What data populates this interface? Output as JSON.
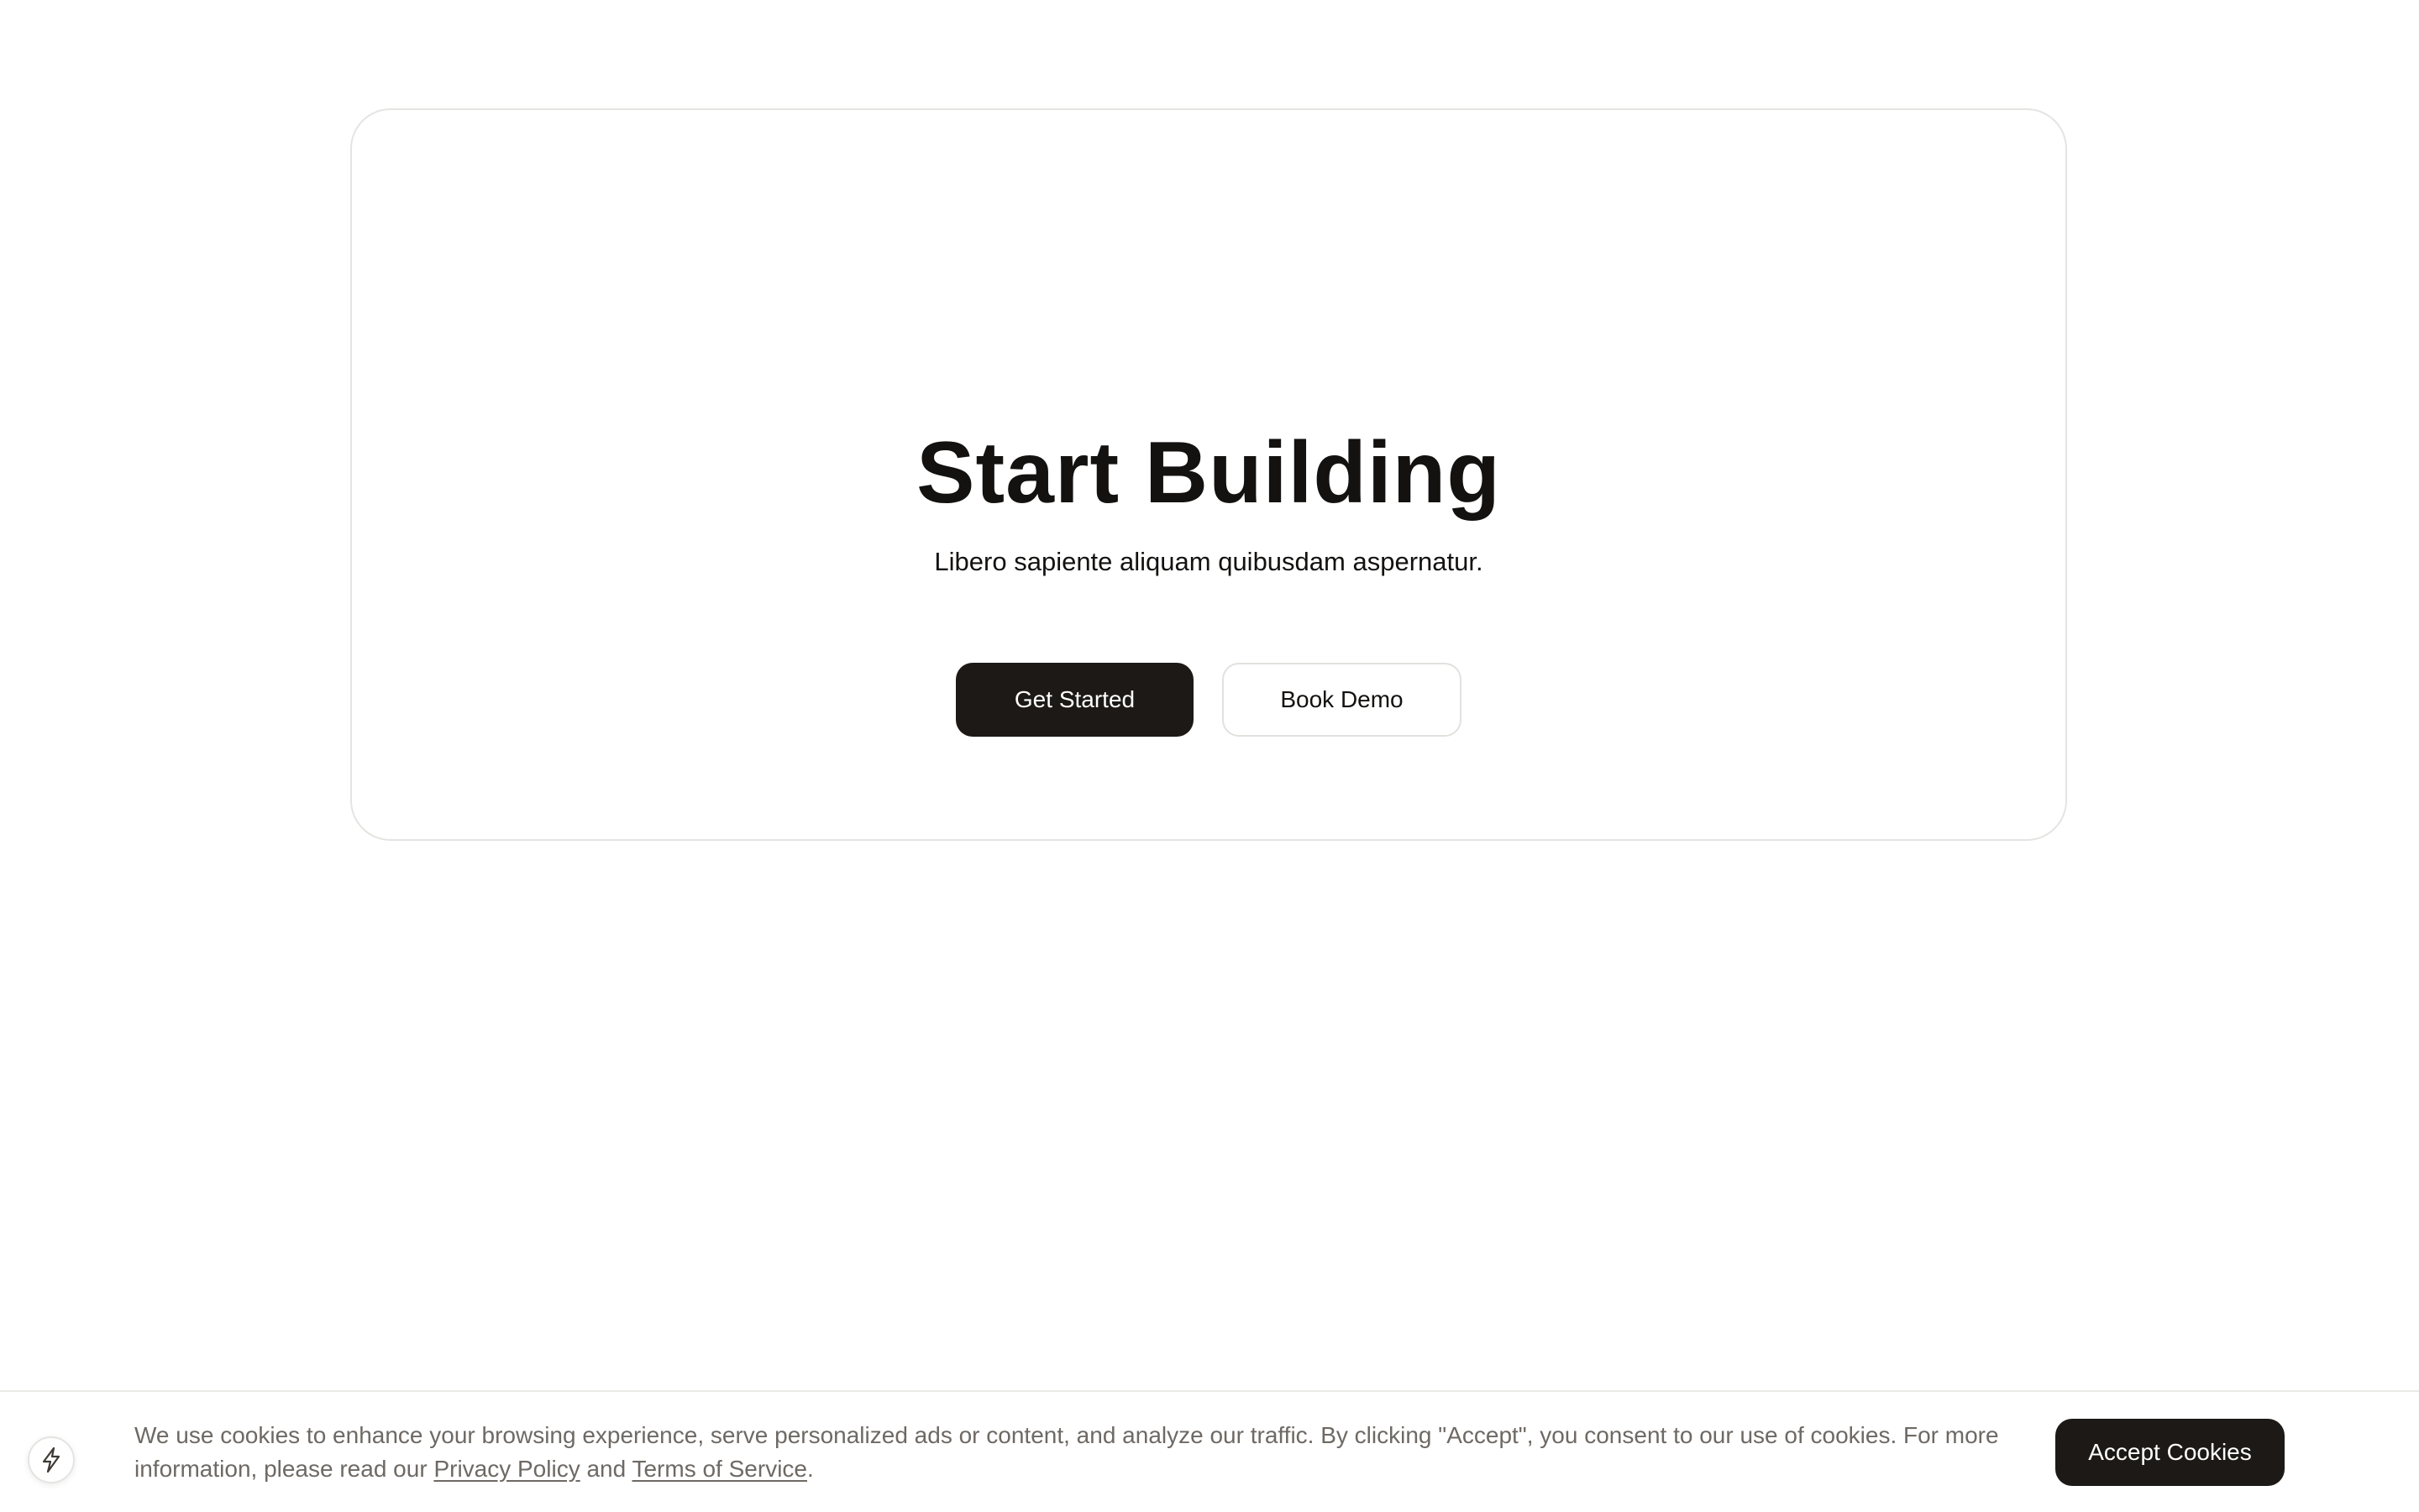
{
  "hero": {
    "title": "Start Building",
    "subtitle": "Libero sapiente aliquam quibusdam aspernatur.",
    "primary_button": "Get Started",
    "secondary_button": "Book Demo"
  },
  "cookie_banner": {
    "badge_icon": "lightning-bolt-icon",
    "text_before": "We use cookies to enhance your browsing experience, serve personalized ads or content, and analyze our traffic. By clicking \"Accept\", you consent to our use of cookies. For more information, please read our ",
    "privacy_link": "Privacy Policy",
    "text_middle": " and ",
    "terms_link": "Terms of Service",
    "text_after": ".",
    "accept_button": "Accept Cookies"
  },
  "colors": {
    "primary_button_bg": "#1c1916",
    "text_dark": "#141210",
    "text_muted": "#6e6964",
    "border": "#e6e4e1"
  }
}
